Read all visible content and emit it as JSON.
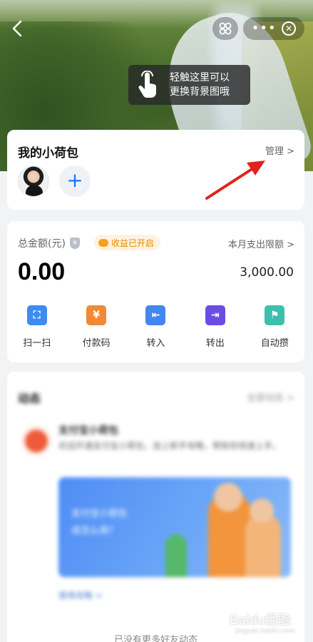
{
  "header": {
    "back_icon": "chevron-left-icon",
    "scan_icon": "scan-icon",
    "more_icon": "more-dots-icon",
    "more_glyph": "•••",
    "close_icon": "close-circle-icon",
    "close_glyph": "✕",
    "tip_line1": "轻触这里可以",
    "tip_line2": "更换背景图哦"
  },
  "purse": {
    "title": "我的小荷包",
    "manage_label": "管理 >",
    "add_glyph": "+"
  },
  "balance": {
    "total_label": "总金额(元)",
    "shield_glyph": "¥",
    "earnings_badge": "收益已开启",
    "amount": "0.00",
    "limit_label": "本月支出限额 >",
    "limit_value": "3,000.00"
  },
  "actions": [
    {
      "label": "扫一扫",
      "icon": "scan-icon",
      "glyph": "⛶",
      "color": "#3e8cf0"
    },
    {
      "label": "付款码",
      "icon": "pay-code-icon",
      "glyph": "¥",
      "color": "#f08a36"
    },
    {
      "label": "转入",
      "icon": "transfer-in-icon",
      "glyph": "⇤",
      "color": "#4286f0"
    },
    {
      "label": "转出",
      "icon": "transfer-out-icon",
      "glyph": "⇥",
      "color": "#6b4de6"
    },
    {
      "label": "自动攒",
      "icon": "flag-icon",
      "glyph": "⚑",
      "color": "#3dbfae"
    }
  ],
  "feed": {
    "title": "动态",
    "more": "全部动态 >",
    "name": "支付宝小荷包",
    "desc": "欢迎开通支付宝小荷包，送上新手攻略，帮助你快速上手。",
    "banner_line1": "支付宝小荷包",
    "banner_line2": "成怎么用？",
    "link": "使用攻略 >",
    "end_text": "已没有更多好友动态"
  },
  "watermark": {
    "brand": "Baidu经验",
    "sub": "jingyan.baidu.com"
  },
  "colors": {
    "accent": "#1677ff",
    "arrow": "#e0231c",
    "earnings": "#e08a00"
  }
}
